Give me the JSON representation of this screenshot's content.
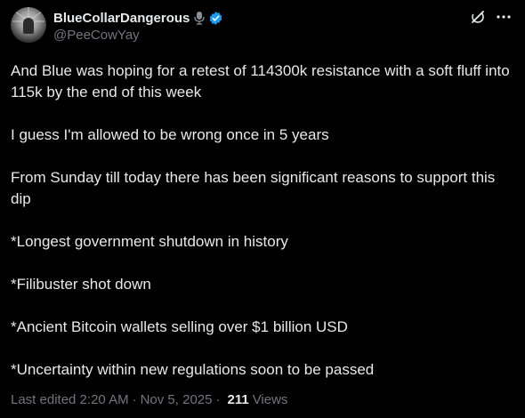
{
  "author": {
    "display_name": "BlueCollarDangerous",
    "handle": "@PeeCowYay"
  },
  "icons": {
    "avatar": "avatar",
    "mic": "microphone-icon",
    "verified": "verified-badge-icon",
    "grok": "grok-icon",
    "more": "more-icon"
  },
  "colors": {
    "background": "#000000",
    "text": "#e7e9ea",
    "muted": "#71767b",
    "verified": "#1d9bf0"
  },
  "post": {
    "paragraphs": [
      "And Blue was hoping for a retest of 114300k resistance with a soft fluff into 115k by the end of this week",
      "I guess I'm allowed to be wrong once in 5 years",
      "From Sunday till today there has been significant reasons to support this dip",
      "*Longest government shutdown in history",
      "*Filibuster shot down",
      "*Ancient Bitcoin wallets selling over $1 billion USD",
      "*Uncertainty within new regulations soon to be passed"
    ],
    "edited_label": "Last edited 2:20 AM",
    "separator": "·",
    "date": "Nov 5, 2025",
    "views_count": "211",
    "views_label": "Views"
  }
}
